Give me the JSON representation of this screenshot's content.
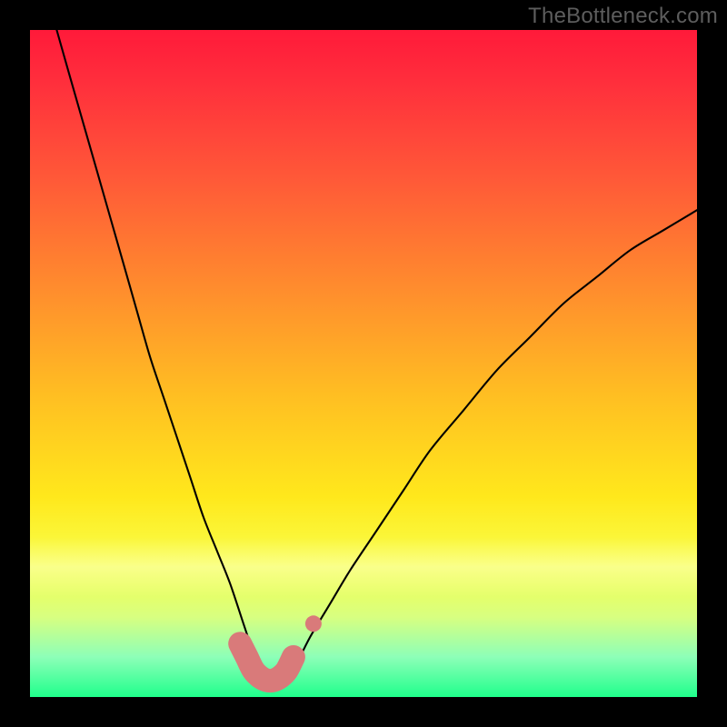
{
  "watermark": "TheBottleneck.com",
  "chart_data": {
    "type": "line",
    "title": "",
    "xlabel": "",
    "ylabel": "",
    "xlim": [
      0,
      100
    ],
    "ylim": [
      0,
      100
    ],
    "grid": false,
    "legend": false,
    "series": [
      {
        "name": "bottleneck-curve",
        "x": [
          4,
          6,
          8,
          10,
          12,
          14,
          16,
          18,
          20,
          22,
          24,
          26,
          28,
          30,
          32,
          33,
          34,
          35,
          36,
          37,
          38,
          39,
          40,
          42,
          45,
          48,
          52,
          56,
          60,
          65,
          70,
          75,
          80,
          85,
          90,
          95,
          100
        ],
        "y": [
          100,
          93,
          86,
          79,
          72,
          65,
          58,
          51,
          45,
          39,
          33,
          27,
          22,
          17,
          11,
          8,
          5,
          3,
          2,
          2,
          2,
          3,
          5,
          9,
          14,
          19,
          25,
          31,
          37,
          43,
          49,
          54,
          59,
          63,
          67,
          70,
          73
        ]
      },
      {
        "name": "highlighted-bottom-trace",
        "x": [
          31.5,
          32.5,
          33.5,
          34.5,
          35.5,
          36.5,
          37.5,
          38.5,
          39.5
        ],
        "y": [
          8,
          6,
          4,
          3,
          2.5,
          2.5,
          3,
          4,
          6
        ]
      }
    ],
    "annotations": [
      {
        "name": "isolated-dot",
        "x": 42.5,
        "y": 11
      }
    ],
    "colors": {
      "curve": "#000000",
      "highlight": "#d97a7a",
      "gradient_top": "#ff1a3a",
      "gradient_mid": "#ffe81c",
      "gradient_bottom": "#1fff8c"
    }
  }
}
